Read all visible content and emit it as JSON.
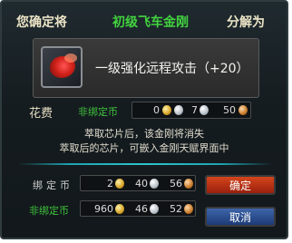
{
  "title": {
    "left": "您确定将",
    "middle": "初级飞车金刚",
    "right": "分解为"
  },
  "skill": {
    "name": "一级强化远程攻击（+20）",
    "icon": "red-crystal-icon"
  },
  "cost": {
    "label": "花费",
    "unbound_label": "非绑定币",
    "gold": "0",
    "silver": "7",
    "copper": "50"
  },
  "info": {
    "line1": "萃取芯片后，该金刚将消失",
    "line2": "萃取后的芯片，可嵌入金刚天赋界面中"
  },
  "balance": {
    "bound_label": "绑定币",
    "bound_gold": "2",
    "bound_silver": "40",
    "bound_copper": "56",
    "unbound_label": "非绑定币",
    "unbound_gold": "960",
    "unbound_silver": "46",
    "unbound_copper": "52"
  },
  "buttons": {
    "confirm": "确定",
    "cancel": "取消"
  },
  "colors": {
    "green_text": "#43d33f",
    "confirm_button": "#d4451c",
    "cancel_button": "#3e65a8",
    "divider": "#2ec4cf"
  }
}
